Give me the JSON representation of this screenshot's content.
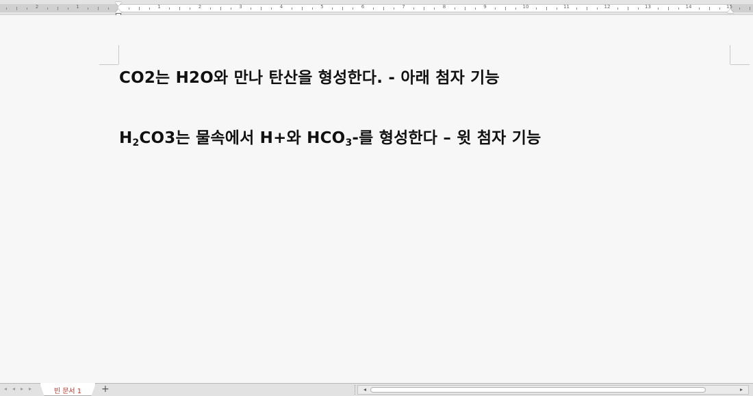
{
  "ruler": {
    "numbers": [
      "2",
      "1",
      "1",
      "2",
      "3",
      "4",
      "5",
      "6",
      "7",
      "8",
      "9",
      "10",
      "11",
      "12",
      "13",
      "14",
      "15"
    ]
  },
  "document": {
    "line1": "CO2는 H2O와 만나 탄산을 형성한다. - 아래 첨자 기능",
    "line2": {
      "part1": "H",
      "sub1": "2",
      "part2": "CO3는 물속에서 H+와 HCO",
      "sub2": "3",
      "part3": "-를 형성한다 – 윗 첨자 기능"
    }
  },
  "tabbar": {
    "nav_first": "◂",
    "nav_prev": "◂",
    "nav_next": "▸",
    "nav_last": "▸",
    "tab_label": "빈 문서 1",
    "add_tab": "+",
    "scroll_left": "◂",
    "scroll_right": "▸"
  }
}
